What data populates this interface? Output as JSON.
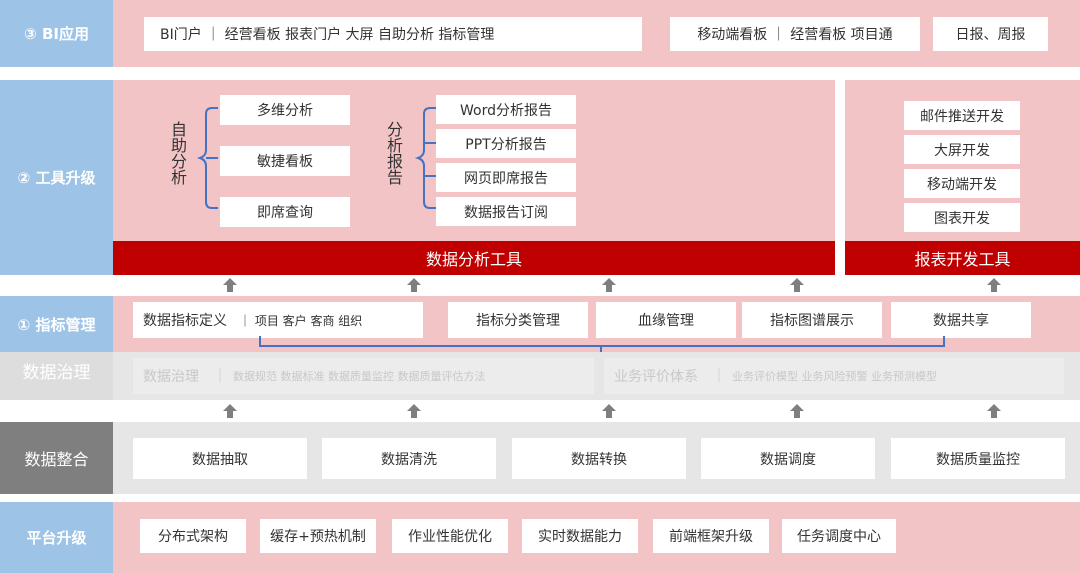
{
  "rows": {
    "bi": {
      "label": "③ BI应用",
      "box1": "BI门户 ｜ 经营看板  报表门户  大屏   自助分析  指标管理",
      "box2": "移动端看板 ｜ 经营看板  项目通",
      "box3": "日报、周报"
    },
    "tools": {
      "label": "② 工具升级",
      "self_analysis_vertical": "自助分析",
      "self_analysis_items": [
        "多维分析",
        "敏捷看板",
        "即席查询"
      ],
      "report_vertical": "分析报告",
      "report_items": [
        "Word分析报告",
        "PPT分析报告",
        "网页即席报告",
        "数据报告订阅"
      ],
      "analysis_bar": "数据分析工具",
      "dev_items": [
        "邮件推送开发",
        "大屏开发",
        "移动端开发",
        "图表开发"
      ],
      "dev_bar": "报表开发工具"
    },
    "metrics": {
      "label": "① 指标管理",
      "def_main": "数据指标定义",
      "def_sub": "｜ 项目  客户  客商  组织",
      "items": [
        "指标分类管理",
        "血缘管理",
        "指标图谱展示",
        "数据共享"
      ]
    },
    "governance": {
      "label": "数据治理",
      "left_main": "数据治理",
      "left_sep": "｜",
      "left_sub": "数据规范   数据标准   数据质量监控   数据质量评估方法",
      "right_main": "业务评价体系",
      "right_sep": "｜",
      "right_sub": "业务评价模型   业务风险预警  业务预测模型"
    },
    "integration": {
      "label": "数据整合",
      "items": [
        "数据抽取",
        "数据清洗",
        "数据转换",
        "数据调度",
        "数据质量监控"
      ]
    },
    "platform": {
      "label": "平台升级",
      "items": [
        "分布式架构",
        "缓存+预热机制",
        "作业性能优化",
        "实时数据能力",
        "前端框架升级",
        "任务调度中心"
      ]
    }
  },
  "colors": {
    "pink_band": "#f2c4c5",
    "blue_label": "#9dc3e6",
    "red_bar": "#c00000",
    "grey_label": "#7f7f7f",
    "arrow": "#7f7f7f",
    "bracket": "#4472c4"
  },
  "icons": {
    "up_arrow": "up-arrow-icon"
  }
}
